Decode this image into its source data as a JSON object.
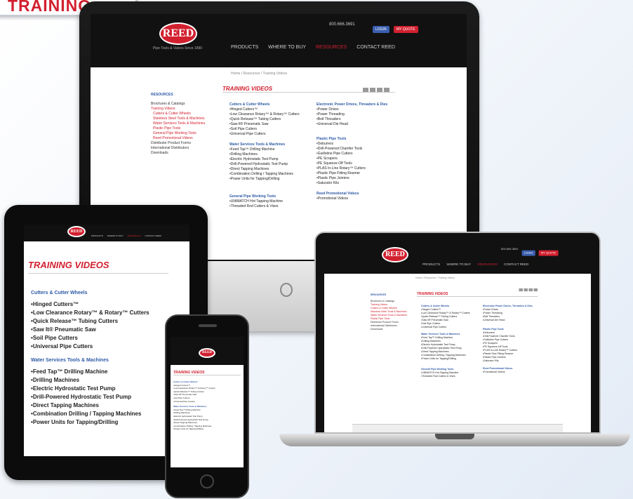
{
  "badge": {
    "label": "TRAINING"
  },
  "site": {
    "logo": "REED",
    "logo_tagline": "Pipe Tools & Valves Since 1890",
    "nav": [
      "PRODUCTS",
      "WHERE TO BUY",
      "RESOURCES",
      "CONTACT REED"
    ],
    "nav_active": "RESOURCES",
    "phone": "800.666.3691",
    "header_buttons": [
      "LOGIN",
      "MY QUOTE"
    ],
    "breadcrumb": "Home / Resources / Training Videos",
    "page_title": "TRAINING VIDEOS",
    "sidebar": {
      "heading": "RESOURCES",
      "items": [
        "Brochures & Catalogs",
        "Training Videos",
        "Distributor Product Forms",
        "International Distributors",
        "Downloads"
      ],
      "sub_items": [
        "Cutters & Cutter Wheels",
        "Stainless Steel Tools & Machines",
        "Water Services Tools & Machines",
        "Plastic Pipe Tools",
        "General Pipe Working Tools",
        "Reed Promotional Videos"
      ]
    },
    "categories": [
      {
        "title": "Cutters & Cutter Wheels",
        "items": [
          "Hinged Cutters™",
          "Low Clearance Rotary™ & Rotary™ Cutters",
          "Quick Release™ Tubing Cutters",
          "Saw It® Pneumatic Saw",
          "Soil Pipe Cutters",
          "Universal Pipe Cutters"
        ]
      },
      {
        "title": "Water Services Tools & Machines",
        "items": [
          "Feed Tap™ Drilling Machine",
          "Drilling Machines",
          "Electric Hydrostatic Test Pump",
          "Drill-Powered Hydrostatic Test Pump",
          "Direct Tapping Machines",
          "Combination Drilling / Tapping Machines",
          "Power Units for Tapping/Drilling"
        ]
      },
      {
        "title": "General Pipe Working Tools",
        "items": [
          "UNIMATCH Hot Tapping Machine",
          "Threaded Rod Cutters & Vises"
        ]
      },
      {
        "title": "Electronic Power Drives, Threaders & Dies",
        "items": [
          "Power Drives",
          "Power Threading",
          "Bolt Threaders",
          "Universal Die Head"
        ]
      },
      {
        "title": "Plastic Pipe Tools",
        "items": [
          "Deburrers",
          "Drill-Powered Chamfer Tools",
          "Guillotine Pipe Cutters",
          "PE Scrapers",
          "PE Squeeze-Off Tools",
          "PLAS In-Line Rotary™ Cutters",
          "Plastic Pipe Fitting Reamer",
          "Plastic Pipe Jointers",
          "Saturator Kits"
        ]
      },
      {
        "title": "Reed Promotional Videos",
        "items": [
          "Promotional Videos"
        ]
      }
    ]
  }
}
